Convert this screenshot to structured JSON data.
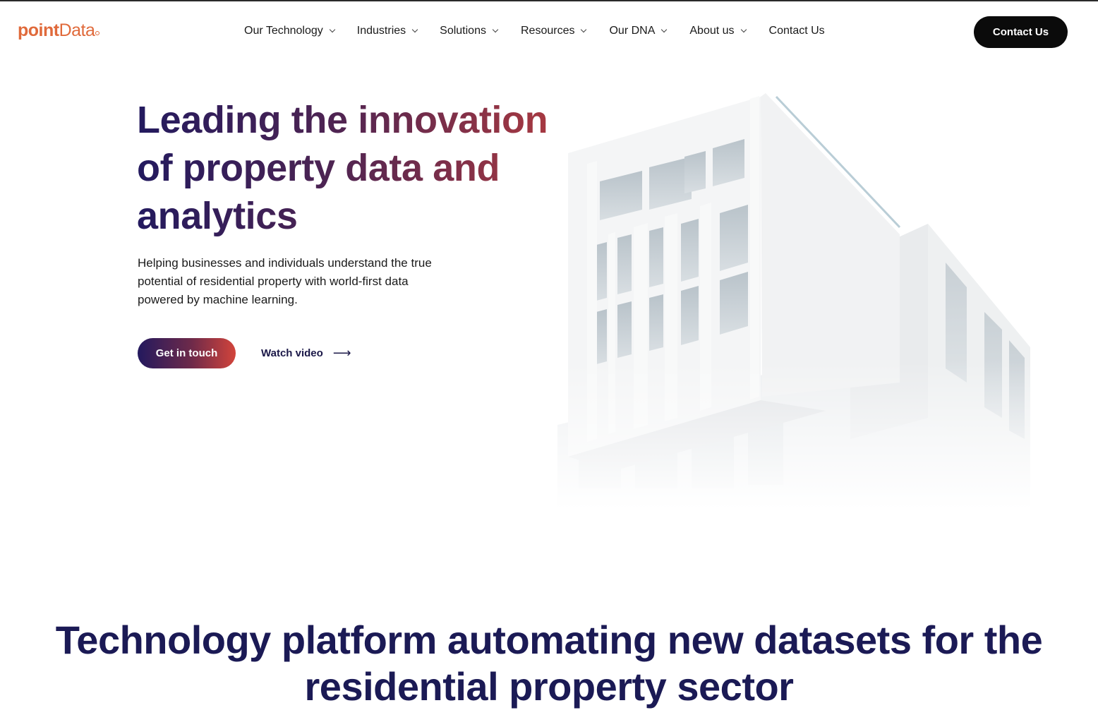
{
  "header": {
    "logo": {
      "part1": "point",
      "part2": "Data"
    },
    "nav": [
      {
        "label": "Our Technology",
        "has_dropdown": true
      },
      {
        "label": "Industries",
        "has_dropdown": true
      },
      {
        "label": "Solutions",
        "has_dropdown": true
      },
      {
        "label": "Resources",
        "has_dropdown": true
      },
      {
        "label": "Our DNA",
        "has_dropdown": true
      },
      {
        "label": "About us",
        "has_dropdown": true
      },
      {
        "label": "Contact Us",
        "has_dropdown": false
      }
    ],
    "cta_label": "Contact Us"
  },
  "hero": {
    "title": {
      "line1_a": "Leading the ",
      "line1_b": "innovation",
      "line2_a": "of ",
      "line2_bold": "property data",
      "line2_b": " and",
      "line3_bold": "analytics"
    },
    "subtitle": "Helping businesses and individuals understand the true potential of residential property with world-first data powered by machine learning.",
    "primary_button": "Get in touch",
    "secondary_button": "Watch video",
    "secondary_icon": "arrow-right-icon",
    "image": "building-photo"
  },
  "section": {
    "title_a": "Technology platform ",
    "title_bold1": "automating new datasets",
    "title_b": " for the residential property sector"
  },
  "colors": {
    "logo": "#e06a3b",
    "gradient_start": "#231a5e",
    "gradient_end": "#d2443b",
    "cta_dark": "#0b0b0b",
    "section_title": "#1b1a55"
  }
}
